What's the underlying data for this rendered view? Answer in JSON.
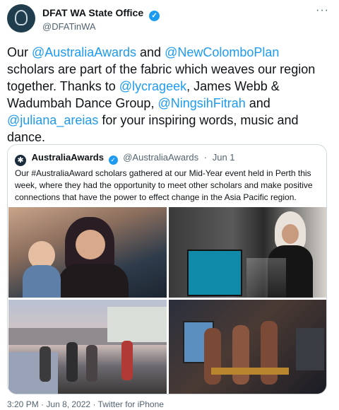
{
  "author": {
    "name": "DFAT WA State Office",
    "handle": "@DFATinWA",
    "verified_icon": "verified-badge-icon"
  },
  "more_icon": "···",
  "tweet": {
    "t1": "Our ",
    "m1": "@AustraliaAwards",
    "t2": " and ",
    "m2": "@NewColomboPlan",
    "t3": " scholars are part of the fabric which weaves our region together. Thanks to ",
    "m3": "@lycrageek",
    "t4": ", James Webb & Wadumbah Dance Group, ",
    "m4": "@NingsihFitrah",
    "t5": " and ",
    "m5": "@juliana_areias",
    "t6": " for your inspiring words, music and dance."
  },
  "quote": {
    "name": "AustraliaAwards",
    "handle": "@AustraliaAwards",
    "separator": "·",
    "date": "Jun 1",
    "text": "Our #AustraliaAward scholars gathered at our Mid-Year event held in Perth this week, where they had the opportunity to meet other scholars and make positive connections that have the power to effect change in the Asia Pacific region."
  },
  "footer": {
    "time": "3:20 PM",
    "separator": "·",
    "date": "Jun 8, 2022",
    "source": "Twitter for iPhone"
  },
  "colors": {
    "link": "#1d9bf0",
    "text": "#0f1419",
    "secondary": "#536471",
    "border": "#cfd9de"
  }
}
